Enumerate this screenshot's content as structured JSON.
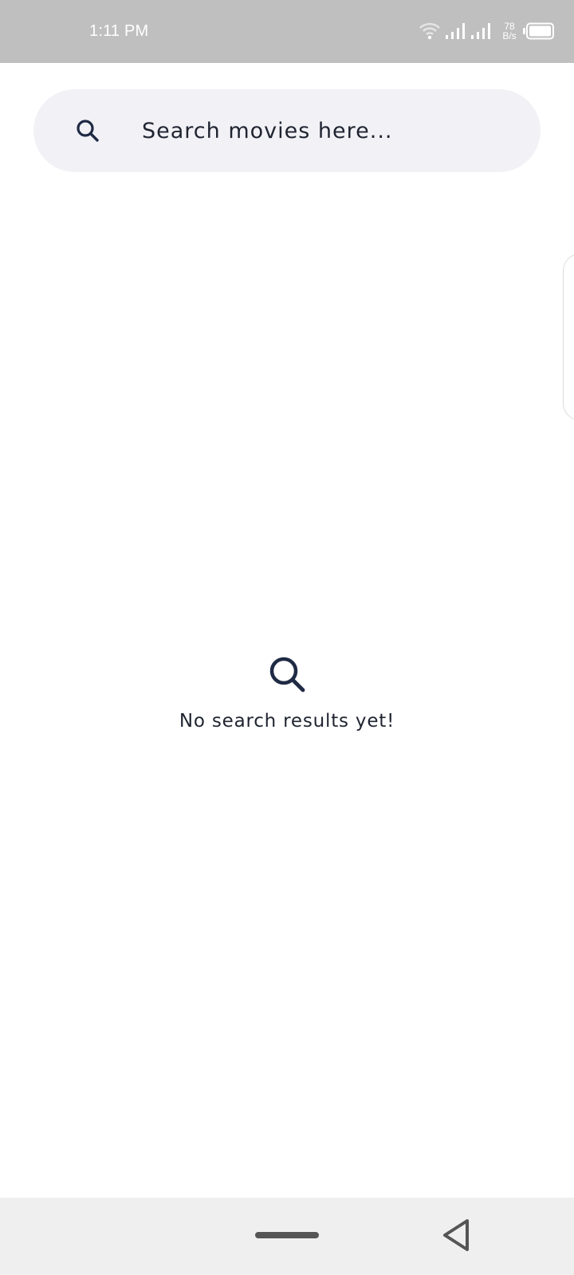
{
  "status_bar": {
    "time": "1:11 PM",
    "net_speed_value": "78",
    "net_speed_unit": "B/s",
    "icons": [
      "wifi-icon",
      "signal-icon",
      "signal-icon",
      "battery-icon"
    ]
  },
  "search": {
    "placeholder": "Search movies here...",
    "value": "",
    "icon": "search-icon"
  },
  "empty_state": {
    "icon": "search-icon",
    "message": "No search results yet!"
  },
  "navigation": {
    "icons": [
      "home-pill",
      "back-icon"
    ]
  },
  "colors": {
    "status_bar_bg": "#bfbfbf",
    "search_bar_bg": "#f1f1f6",
    "text_dark": "#1f2430",
    "nav_bar_bg": "#efefef"
  }
}
